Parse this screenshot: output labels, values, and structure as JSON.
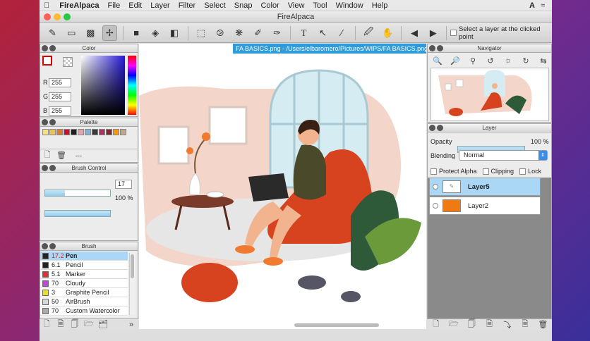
{
  "menubar": {
    "app": "FireAlpaca",
    "items": [
      "File",
      "Edit",
      "Layer",
      "Filter",
      "Select",
      "Snap",
      "Color",
      "View",
      "Tool",
      "Window",
      "Help"
    ]
  },
  "window": {
    "title": "FireAlpaca",
    "canvas_tab": "FA BASICS.png - /Users/elbaromero/Pictures/WIPS/FA BASICS.png"
  },
  "toolbar": {
    "select_layer_label": "Select a layer at the clicked point"
  },
  "color_panel": {
    "title": "Color",
    "r_label": "R",
    "g_label": "G",
    "b_label": "B",
    "r": "255",
    "g": "255",
    "b": "255"
  },
  "palette_panel": {
    "title": "Palette",
    "name": "---",
    "colors": [
      "#f7e27a",
      "#f2c14a",
      "#e07a2a",
      "#c8102e",
      "#1d1d1d",
      "#e8a0b0",
      "#7fb3d5",
      "#3a3a3a",
      "#b03060",
      "#7a2a2a",
      "#ff9900",
      "#bfa888"
    ]
  },
  "brush_control": {
    "title": "Brush Control",
    "size": "17",
    "size_fraction": 0.3,
    "opacity": "100 %",
    "opacity_fraction": 1.0
  },
  "brush_panel": {
    "title": "Brush",
    "items": [
      {
        "size": "17.2",
        "name": "Pen",
        "color": "#222222",
        "selected": true
      },
      {
        "size": "6.1",
        "name": "Pencil",
        "color": "#222222"
      },
      {
        "size": "5.1",
        "name": "Marker",
        "color": "#e03030"
      },
      {
        "size": "70",
        "name": "Cloudy",
        "color": "#c040e0"
      },
      {
        "size": "3",
        "name": "Graphite Pencil",
        "color": "#e8e020"
      },
      {
        "size": "50",
        "name": "AirBrush",
        "color": "#d8d8d8"
      },
      {
        "size": "70",
        "name": "Custom Watercolor",
        "color": "#aaaaaa"
      }
    ]
  },
  "navigator": {
    "title": "Navigator"
  },
  "layer_panel": {
    "title": "Layer",
    "opacity_label": "Opacity",
    "opacity": "100 %",
    "opacity_fraction": 1.0,
    "blending_label": "Blending",
    "blending": "Normal",
    "protect_alpha": "Protect Alpha",
    "clipping": "Clipping",
    "lock": "Lock",
    "layers": [
      {
        "name": "Layer5",
        "selected": true
      },
      {
        "name": "Layer2",
        "color": "#f07a10"
      }
    ]
  }
}
